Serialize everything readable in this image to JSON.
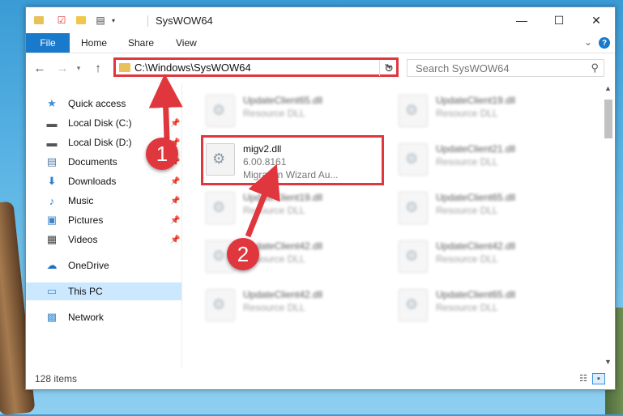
{
  "window": {
    "title": "SysWOW64"
  },
  "ribbon": {
    "tabs": [
      "File",
      "Home",
      "Share",
      "View"
    ]
  },
  "nav": {
    "back": "←",
    "forward": "→",
    "up": "↑",
    "path": "C:\\Windows\\SysWOW64",
    "refresh": "↻"
  },
  "search": {
    "placeholder": "Search SysWOW64"
  },
  "sidebar": {
    "items": [
      {
        "label": "Quick access",
        "icon": "star-icon",
        "glyph": "★",
        "color": "#3c8fd8",
        "pinned": false
      },
      {
        "label": "Local Disk (C:)",
        "icon": "drive-icon",
        "glyph": "▬",
        "color": "#555555",
        "pinned": true
      },
      {
        "label": "Local Disk (D:)",
        "icon": "drive-icon",
        "glyph": "▬",
        "color": "#555555",
        "pinned": true
      },
      {
        "label": "Documents",
        "icon": "documents-icon",
        "glyph": "▤",
        "color": "#5a7da8",
        "pinned": true
      },
      {
        "label": "Downloads",
        "icon": "downloads-icon",
        "glyph": "⬇",
        "color": "#2f7fd0",
        "pinned": true
      },
      {
        "label": "Music",
        "icon": "music-icon",
        "glyph": "♪",
        "color": "#2f7fd0",
        "pinned": true
      },
      {
        "label": "Pictures",
        "icon": "pictures-icon",
        "glyph": "▣",
        "color": "#3d87c8",
        "pinned": true
      },
      {
        "label": "Videos",
        "icon": "videos-icon",
        "glyph": "▦",
        "color": "#444444",
        "pinned": true
      },
      {
        "label": "OneDrive",
        "icon": "onedrive-icon",
        "glyph": "☁",
        "color": "#1f6fc4",
        "pinned": false
      },
      {
        "label": "This PC",
        "icon": "computer-icon",
        "glyph": "▭",
        "color": "#3c8fd8",
        "pinned": false
      },
      {
        "label": "Network",
        "icon": "network-icon",
        "glyph": "▩",
        "color": "#3c8fd8",
        "pinned": false
      }
    ]
  },
  "files": [
    {
      "name": "UpdateClient65.dll",
      "type": "Resource DLL",
      "desc": "",
      "blurred": true
    },
    {
      "name": "UpdateClient19.dll",
      "type": "Resource DLL",
      "desc": "",
      "blurred": true
    },
    {
      "name": "migv2.dll",
      "type": "6.00.8161",
      "desc": "Migration Wizard Au...",
      "blurred": false
    },
    {
      "name": "UpdateClient21.dll",
      "type": "Resource DLL",
      "desc": "",
      "blurred": true
    },
    {
      "name": "UpdateClient19.dll",
      "type": "Resource DLL",
      "desc": "",
      "blurred": true
    },
    {
      "name": "UpdateClient65.dll",
      "type": "Resource DLL",
      "desc": "",
      "blurred": true
    },
    {
      "name": "UpdateClient42.dll",
      "type": "Resource DLL",
      "desc": "",
      "blurred": true
    },
    {
      "name": "UpdateClient42.dll",
      "type": "Resource DLL",
      "desc": "",
      "blurred": true
    },
    {
      "name": "UpdateClient42.dll",
      "type": "Resource DLL",
      "desc": "",
      "blurred": true
    },
    {
      "name": "UpdateClient65.dll",
      "type": "Resource DLL",
      "desc": "",
      "blurred": true
    }
  ],
  "status": {
    "items": "128 items"
  },
  "callouts": [
    "1",
    "2"
  ],
  "colors": {
    "accent": "#1979ca",
    "highlight": "#e0373f",
    "selection": "#cce8ff"
  }
}
